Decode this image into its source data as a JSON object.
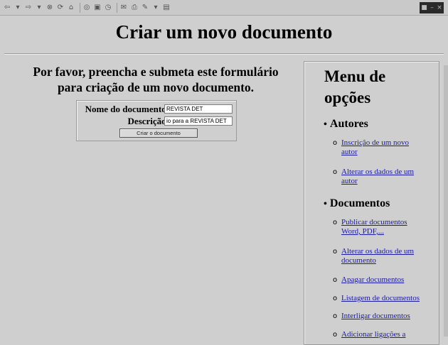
{
  "page": {
    "title": "Criar um novo documento",
    "intro_line1": "Por favor, preencha e submeta este formulário",
    "intro_line2": "para criação de um novo documento."
  },
  "form": {
    "name_label": "Nome do documento:",
    "name_value": "REVISTA DET",
    "description_label": "Descrição:",
    "description_value": "io para a REVISTA DET",
    "submit_label": "Criar o documento"
  },
  "menu": {
    "title_line1": "Menu de",
    "title_line2": "opções",
    "sections": [
      {
        "title": "Autores",
        "items": [
          {
            "line1": "Inscrição de um novo",
            "line2": "autor"
          },
          {
            "line1": "Alterar os dados de um",
            "line2": "autor"
          }
        ]
      },
      {
        "title": "Documentos",
        "items": [
          {
            "line1": "Publicar documentos",
            "line2": "Word, PDF,..."
          },
          {
            "line1": "Alterar os dados de um",
            "line2": "documento"
          },
          {
            "line1": "Apagar documentos",
            "line2": ""
          },
          {
            "line1": "Listagem de documentos",
            "line2": ""
          },
          {
            "line1": "Interligar documentos",
            "line2": ""
          },
          {
            "line1": "Adicionar ligações a",
            "line2": ""
          }
        ]
      }
    ]
  },
  "toolbar": {
    "icons": [
      "back-icon",
      "forward-icon",
      "stop-icon",
      "refresh-icon",
      "home-icon",
      "search-icon",
      "favorites-icon",
      "history-icon",
      "mail-icon",
      "print-icon",
      "edit-icon",
      "discuss-icon"
    ]
  },
  "colors": {
    "background": "#cfcfcf",
    "link": "#1a1aa6"
  }
}
